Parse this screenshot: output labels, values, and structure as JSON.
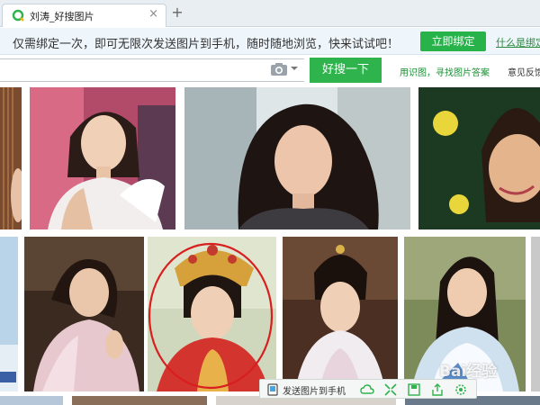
{
  "browser": {
    "tab_title": "刘涛_好搜图片",
    "tab_close": "×",
    "new_tab": "+"
  },
  "promo": {
    "text": "仅需绑定一次，即可无限次发送图片到手机，随时随地浏览，快来试试吧！",
    "button": "立即绑定",
    "link": "什么是绑定"
  },
  "search": {
    "value": "",
    "button": "好搜一下",
    "link_identify": "用识图，寻找图片答案",
    "link_feedback": "意见反馈"
  },
  "toolbar": {
    "send_label": "发送图片到手机"
  },
  "watermark": "Bai经验",
  "colors": {
    "accent": "#2eb34d",
    "promo_bg": "#eef5fb",
    "tab_bg": "#e9eef3"
  }
}
